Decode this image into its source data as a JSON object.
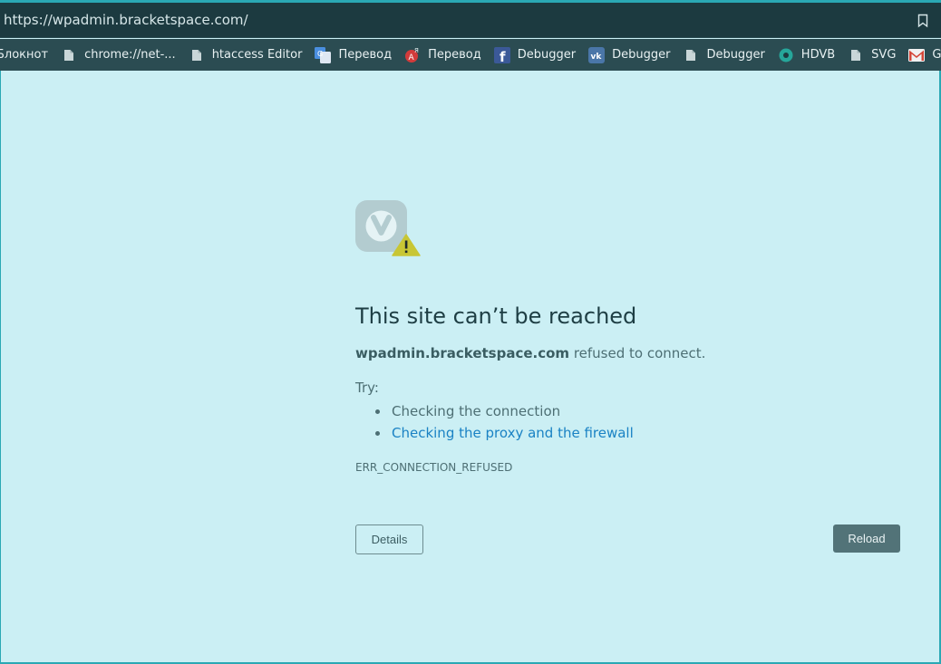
{
  "browser": {
    "url": "https://wpadmin.bracketspace.com/",
    "bookmark_icon": "bookmark-icon"
  },
  "bookmarks": [
    {
      "label": "Блокнот",
      "icon": "none"
    },
    {
      "label": "chrome://net-...",
      "icon": "page-icon"
    },
    {
      "label": "htaccess Editor",
      "icon": "page-icon"
    },
    {
      "label": "Перевод",
      "icon": "google-translate-icon"
    },
    {
      "label": "Перевод",
      "icon": "translate-icon"
    },
    {
      "label": "Debugger",
      "icon": "facebook-icon"
    },
    {
      "label": "Debugger",
      "icon": "vk-icon"
    },
    {
      "label": "Debugger",
      "icon": "page-icon"
    },
    {
      "label": "HDVB",
      "icon": "circle-icon"
    },
    {
      "label": "SVG",
      "icon": "page-icon"
    },
    {
      "label": "Go",
      "icon": "gmail-icon"
    }
  ],
  "error": {
    "icon": "vivaldi-warning-icon",
    "title": "This site can’t be reached",
    "host": "wpadmin.bracketspace.com",
    "message": " refused to connect.",
    "try_label": "Try:",
    "suggestions": [
      {
        "text": "Checking the connection",
        "link": false
      },
      {
        "text": "Checking the proxy and the firewall",
        "link": true
      }
    ],
    "code": "ERR_CONNECTION_REFUSED",
    "details_label": "Details",
    "reload_label": "Reload"
  },
  "colors": {
    "page_bg": "#cbeff4",
    "accent": "#2aa8b4",
    "link": "#1a82c4",
    "reload_bg": "#527378"
  }
}
